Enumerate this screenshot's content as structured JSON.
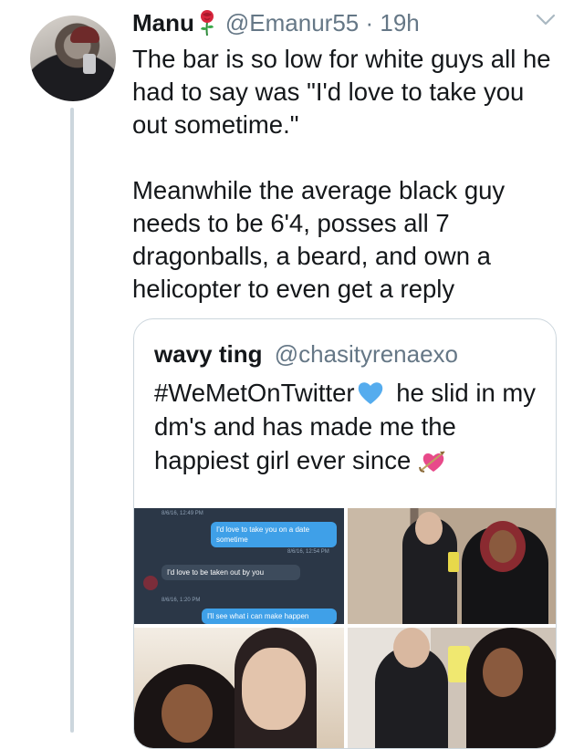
{
  "tweet": {
    "author_name": "Manu",
    "author_handle": "@Emanur55",
    "separator": "·",
    "time": "19h",
    "text": "The bar is so low for white guys all he had to say was \"I'd love to take you out sometime.\"\n\nMeanwhile the average black guy needs to be 6'4, posses all 7 dragonballs, a beard, and own a helicopter to even get a reply",
    "name_emoji": "rose-icon",
    "menu_icon": "chevron-down-icon"
  },
  "quoted_tweet": {
    "author_name": "wavy ting",
    "author_handle": "@chasityrenaexo",
    "hashtag": "#WeMetOnTwitter",
    "text_after_heart": " he slid in my dm's and has made me the happiest girl ever since",
    "heart_emoji": "blue-heart-icon",
    "end_emoji": "heart-with-arrow-icon",
    "dm_screenshot": {
      "timestamp_1": "8/6/16, 12:49 PM",
      "message_1": "I'd love to take you on a date sometime",
      "timestamp_2": "8/6/16, 12:54 PM",
      "message_2": "I'd love to be taken out by you",
      "timestamp_3": "8/6/16, 1:20 PM",
      "message_3": "I'll see what i can make happen"
    }
  },
  "colors": {
    "text": "#14171a",
    "secondary": "#657786",
    "border": "#ccd6dd",
    "twitter_blue": "#1da1f2"
  }
}
